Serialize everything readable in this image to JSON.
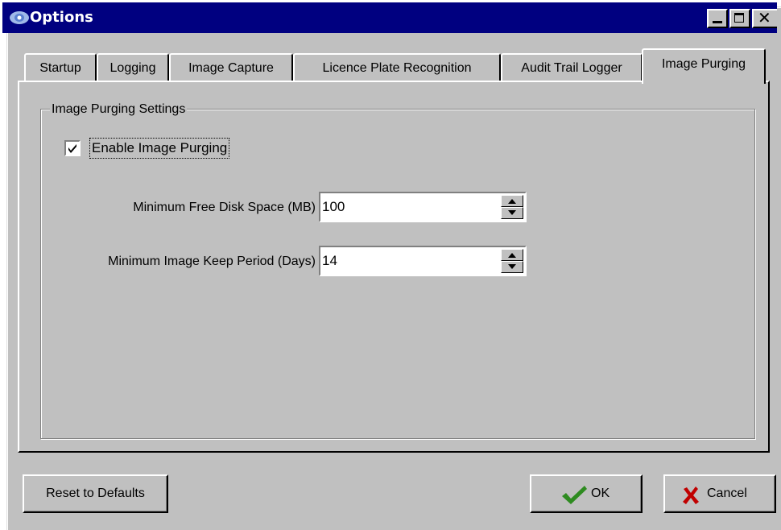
{
  "window": {
    "title": "Options",
    "colors": {
      "face": "#c0c0c0",
      "titlebar": "#000080",
      "ok_check": "#2e8b20",
      "cancel_x": "#c00000"
    }
  },
  "tabs": [
    {
      "label": "Startup",
      "active": false
    },
    {
      "label": "Logging",
      "active": false
    },
    {
      "label": "Image Capture",
      "active": false
    },
    {
      "label": "Licence Plate Recognition",
      "active": false
    },
    {
      "label": "Audit Trail Logger",
      "active": false
    },
    {
      "label": "Image Purging",
      "active": true
    }
  ],
  "purging": {
    "group_title": "Image Purging Settings",
    "enable_label": "Enable Image Purging",
    "enable_checked": true,
    "min_free_space_label": "Minimum Free Disk Space (MB)",
    "min_free_space_value": "100",
    "min_keep_label": "Minimum Image Keep Period (Days)",
    "min_keep_value": "14"
  },
  "buttons": {
    "reset_label": "Reset to Defaults",
    "ok_label": "OK",
    "cancel_label": "Cancel"
  },
  "icons": [
    "app-icon",
    "minimize-icon",
    "maximize-icon",
    "close-icon",
    "checkmark-icon",
    "arrow-up-icon",
    "arrow-down-icon",
    "ok-check-icon",
    "cancel-x-icon"
  ]
}
